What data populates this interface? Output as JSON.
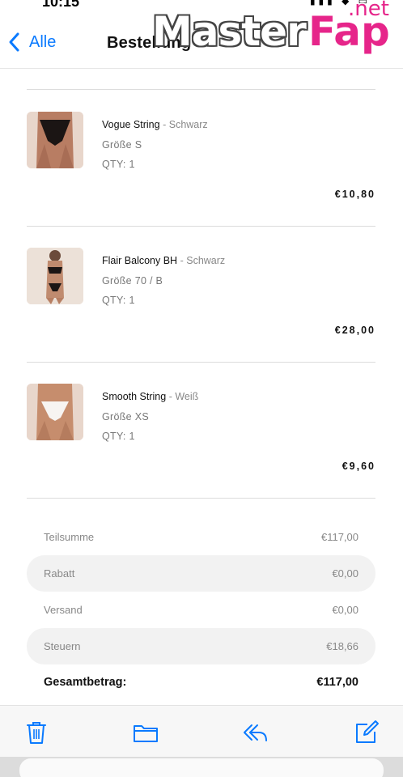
{
  "status_bar": {
    "time": "10:15",
    "icons": "▮▮▮ ◆ ▭"
  },
  "nav": {
    "back_label": "Alle",
    "title": "Bestellung"
  },
  "watermark": {
    "main": "Master",
    "fap": "Fap",
    "net": ".net"
  },
  "items": [
    {
      "name": "Vogue String",
      "separator": "-",
      "color": "Schwarz",
      "size": "Größe S",
      "qty": "QTY: 1",
      "price": "€10,80"
    },
    {
      "name": "Flair Balcony BH",
      "separator": "-",
      "color": "Schwarz",
      "size": "Größe 70 / B",
      "qty": "QTY: 1",
      "price": "€28,00"
    },
    {
      "name": "Smooth String",
      "separator": "-",
      "color": "Weiß",
      "size": "Größe XS",
      "qty": "QTY: 1",
      "price": "€9,60"
    }
  ],
  "summary": {
    "rows": [
      {
        "label": "Teilsumme",
        "value": "€117,00"
      },
      {
        "label": "Rabatt",
        "value": "€0,00"
      },
      {
        "label": "Versand",
        "value": "€0,00"
      },
      {
        "label": "Steuern",
        "value": "€18,66"
      }
    ],
    "total_label": "Gesamtbetrag:",
    "total_value": "€117,00"
  },
  "toolbar": {
    "icons": [
      "trash-icon",
      "folder-icon",
      "reply-icon",
      "compose-icon"
    ],
    "accent": "#0a7aff"
  }
}
